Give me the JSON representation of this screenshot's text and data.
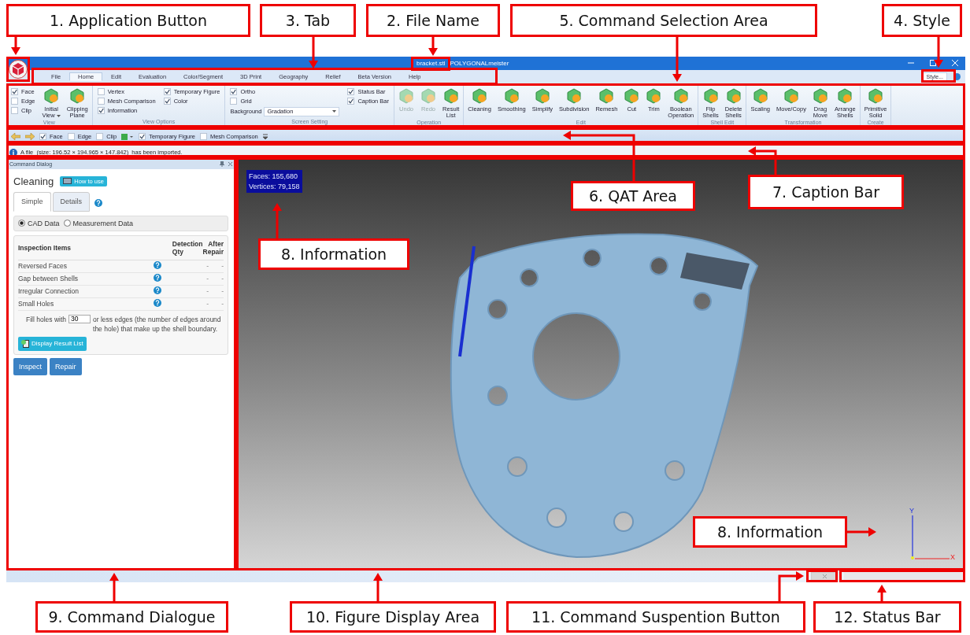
{
  "title_bar": {
    "file_name": "bracket.stl",
    "app_name": "POLYGONALmeister"
  },
  "tabs": [
    {
      "label": "File",
      "selected": false
    },
    {
      "label": "Home",
      "selected": true
    },
    {
      "label": "Edit",
      "selected": false
    },
    {
      "label": "Evaluation",
      "selected": false
    },
    {
      "label": "Color/Segment",
      "selected": false
    },
    {
      "label": "3D Print",
      "selected": false
    },
    {
      "label": "Geography",
      "selected": false
    },
    {
      "label": "Relief",
      "selected": false
    },
    {
      "label": "Beta Version",
      "selected": false
    },
    {
      "label": "Help",
      "selected": false
    }
  ],
  "style_button": "Style...",
  "ribbon_groups": [
    {
      "title": "View",
      "items": [
        {
          "kind": "checks",
          "checks": [
            {
              "label": "Face",
              "checked": true
            },
            {
              "label": "Edge",
              "checked": false
            },
            {
              "label": "Clip",
              "checked": false
            }
          ]
        },
        {
          "kind": "large",
          "label": "Initial\nView",
          "dropdown": true,
          "disabled": false
        },
        {
          "kind": "large",
          "label": "Clipping\nPlane",
          "dropdown": false,
          "disabled": false
        }
      ]
    },
    {
      "title": "View Options",
      "items": [
        {
          "kind": "checks",
          "checks": [
            {
              "label": "Vertex",
              "checked": false
            },
            {
              "label": "Mesh Comparison",
              "checked": false
            },
            {
              "label": "Information",
              "checked": true
            }
          ]
        },
        {
          "kind": "checks",
          "checks": [
            {
              "label": "Temporary Figure",
              "checked": true
            },
            {
              "label": "Color",
              "checked": true
            }
          ]
        }
      ]
    },
    {
      "title": "Screen Setting",
      "items": [
        {
          "kind": "checks",
          "checks": [
            {
              "label": "Ortho",
              "checked": true
            },
            {
              "label": "Grid",
              "checked": false
            }
          ],
          "select": {
            "label": "Background",
            "value": "Gradation"
          }
        },
        {
          "kind": "checks",
          "checks": [
            {
              "label": "Status Bar",
              "checked": true
            },
            {
              "label": "Caption Bar",
              "checked": true
            }
          ]
        }
      ]
    },
    {
      "title": "Operation",
      "items": [
        {
          "kind": "large",
          "label": "Undo",
          "dropdown": false,
          "disabled": true
        },
        {
          "kind": "large",
          "label": "Redo",
          "dropdown": false,
          "disabled": true
        },
        {
          "kind": "large",
          "label": "Result\nList",
          "dropdown": false,
          "disabled": false
        }
      ]
    },
    {
      "title": "Edit",
      "items": [
        {
          "kind": "large",
          "label": "Cleaning",
          "dropdown": false,
          "disabled": false
        },
        {
          "kind": "large",
          "label": "Smoothing",
          "dropdown": false,
          "disabled": false
        },
        {
          "kind": "large",
          "label": "Simplify",
          "dropdown": false,
          "disabled": false
        },
        {
          "kind": "large",
          "label": "Subdivision",
          "dropdown": false,
          "disabled": false
        },
        {
          "kind": "large",
          "label": "Remesh",
          "dropdown": false,
          "disabled": false
        },
        {
          "kind": "large",
          "label": "Cut",
          "dropdown": false,
          "disabled": false
        },
        {
          "kind": "large",
          "label": "Trim",
          "dropdown": false,
          "disabled": false
        },
        {
          "kind": "large",
          "label": "Boolean\nOperation",
          "dropdown": false,
          "disabled": false
        }
      ]
    },
    {
      "title": "Shell Edit",
      "items": [
        {
          "kind": "large",
          "label": "Flip\nShells",
          "dropdown": false,
          "disabled": false
        },
        {
          "kind": "large",
          "label": "Delete\nShells",
          "dropdown": false,
          "disabled": false
        }
      ]
    },
    {
      "title": "Transformation",
      "items": [
        {
          "kind": "large",
          "label": "Scaling",
          "dropdown": false,
          "disabled": false
        },
        {
          "kind": "large",
          "label": "Move/Copy",
          "dropdown": false,
          "disabled": false
        },
        {
          "kind": "large",
          "label": "Drag\nMove",
          "dropdown": false,
          "disabled": false
        },
        {
          "kind": "large",
          "label": "Arrange\nShells",
          "dropdown": false,
          "disabled": false
        }
      ]
    },
    {
      "title": "Create",
      "items": [
        {
          "kind": "large",
          "label": "Primitive\nSolid",
          "dropdown": false,
          "disabled": false
        }
      ]
    }
  ],
  "qat": [
    {
      "kind": "back"
    },
    {
      "kind": "forward"
    },
    {
      "kind": "check",
      "label": "Face",
      "checked": true
    },
    {
      "kind": "check",
      "label": "Edge",
      "checked": false
    },
    {
      "kind": "check",
      "label": "Clip",
      "checked": false
    },
    {
      "kind": "color_dropdown"
    },
    {
      "kind": "check",
      "label": "Temporary Figure",
      "checked": true
    },
    {
      "kind": "check",
      "label": "Mesh Comparison",
      "checked": false
    },
    {
      "kind": "overflow"
    }
  ],
  "caption_bar": {
    "message": "A file  (size: 196.52 × 194.965 × 147.842)  has been imported."
  },
  "command_dialog": {
    "title": "Command Dialog",
    "heading": "Cleaning",
    "help_button": "How to use",
    "tabs": [
      {
        "label": "Simple",
        "selected": true
      },
      {
        "label": "Details",
        "selected": false
      }
    ],
    "radios": [
      {
        "label": "CAD Data",
        "selected": true
      },
      {
        "label": "Measurement Data",
        "selected": false
      }
    ],
    "columns": [
      "Inspection Items",
      "Detection Qty",
      "After Repair"
    ],
    "rows": [
      {
        "name": "Reversed Faces",
        "qty": "-",
        "after": "-"
      },
      {
        "name": "Gap between Shells",
        "qty": "-",
        "after": "-"
      },
      {
        "name": "Irregular Connection",
        "qty": "-",
        "after": "-"
      },
      {
        "name": "Small Holes",
        "qty": "-",
        "after": "-"
      }
    ],
    "fill_prefix": "Fill holes with",
    "fill_value": "30",
    "fill_suffix": "or less edges (the number of edges around the hole) that make up the shell boundary.",
    "result_button": "Display Result List",
    "buttons": [
      "Inspect",
      "Repair"
    ]
  },
  "viewport": {
    "faces": "Faces: 155,680",
    "vertices": "Vertices: 79,158",
    "axis_y": "Y",
    "axis_x": "X"
  },
  "callouts": [
    {
      "label": "1. Application Button"
    },
    {
      "label": "3. Tab"
    },
    {
      "label": "2. File Name"
    },
    {
      "label": "5. Command Selection Area"
    },
    {
      "label": "4. Style"
    },
    {
      "label": "6. QAT Area"
    },
    {
      "label": "7. Caption Bar"
    },
    {
      "label": "8. Information"
    },
    {
      "label": "8. Information"
    },
    {
      "label": "9. Command Dialogue"
    },
    {
      "label": "10. Figure Display Area"
    },
    {
      "label": "11. Command Suspention Button"
    },
    {
      "label": "12. Status Bar"
    }
  ]
}
